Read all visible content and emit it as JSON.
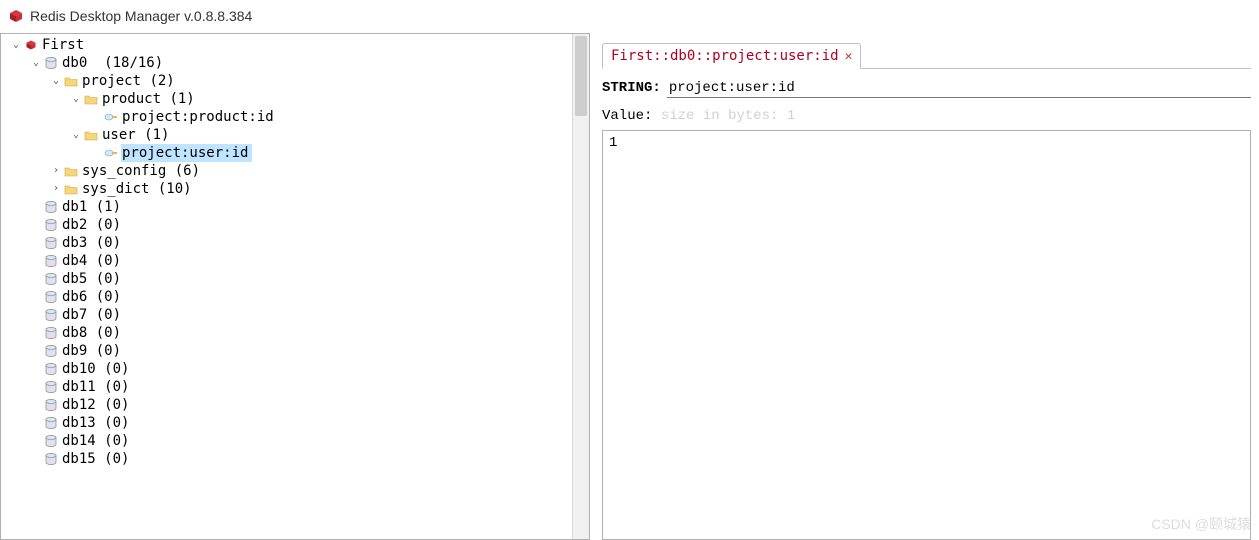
{
  "title": "Redis Desktop Manager v.0.8.8.384",
  "tree": {
    "connection": "First",
    "db0": {
      "name": "db0",
      "count": "(18/16)"
    },
    "project": {
      "name": "project",
      "count": "(2)"
    },
    "product": {
      "name": "product",
      "count": "(1)"
    },
    "product_key": "project:product:id",
    "user": {
      "name": "user",
      "count": "(1)"
    },
    "user_key": "project:user:id",
    "sys_config": {
      "name": "sys_config",
      "count": "(6)"
    },
    "sys_dict": {
      "name": "sys_dict",
      "count": "(10)"
    },
    "dbs": [
      {
        "name": "db1",
        "count": "(1)"
      },
      {
        "name": "db2",
        "count": "(0)"
      },
      {
        "name": "db3",
        "count": "(0)"
      },
      {
        "name": "db4",
        "count": "(0)"
      },
      {
        "name": "db5",
        "count": "(0)"
      },
      {
        "name": "db6",
        "count": "(0)"
      },
      {
        "name": "db7",
        "count": "(0)"
      },
      {
        "name": "db8",
        "count": "(0)"
      },
      {
        "name": "db9",
        "count": "(0)"
      },
      {
        "name": "db10",
        "count": "(0)"
      },
      {
        "name": "db11",
        "count": "(0)"
      },
      {
        "name": "db12",
        "count": "(0)"
      },
      {
        "name": "db13",
        "count": "(0)"
      },
      {
        "name": "db14",
        "count": "(0)"
      },
      {
        "name": "db15",
        "count": "(0)"
      }
    ]
  },
  "detail": {
    "tab_title": "First::db0::project:user:id",
    "type_label": "STRING:",
    "key_name": "project:user:id",
    "value_label": "Value:",
    "size_hint": "size in bytes: 1",
    "value": "1"
  },
  "watermark": "CSDN @颐城猿"
}
